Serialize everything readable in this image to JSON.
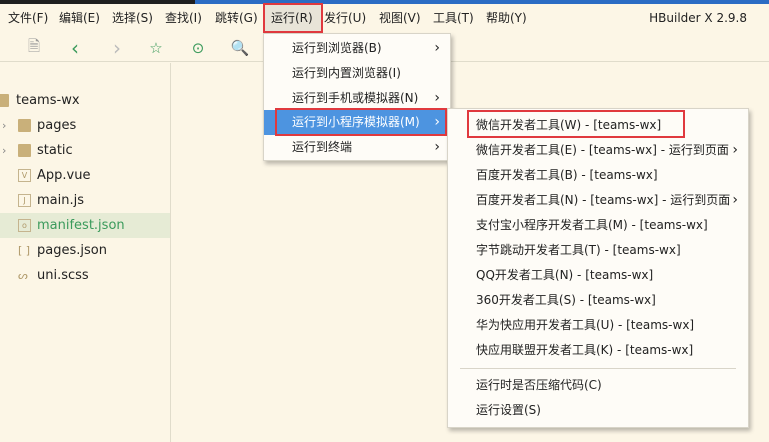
{
  "app_title": "HBuilder X 2.9.8",
  "menubar": [
    "文件(F)",
    "编辑(E)",
    "选择(S)",
    "查找(I)",
    "跳转(G)",
    "运行(R)",
    "发行(U)",
    "视图(V)",
    "工具(T)",
    "帮助(Y)"
  ],
  "toolbar": {
    "icons": [
      "save-icon",
      "back-icon",
      "forward-icon",
      "star-icon",
      "run-icon",
      "preview-search-icon"
    ]
  },
  "tree": {
    "project": "teams-wx",
    "items": [
      {
        "label": "pages",
        "type": "folder"
      },
      {
        "label": "static",
        "type": "folder"
      },
      {
        "label": "App.vue",
        "type": "vue"
      },
      {
        "label": "main.js",
        "type": "js"
      },
      {
        "label": "manifest.json",
        "type": "manifest",
        "selected": true
      },
      {
        "label": "pages.json",
        "type": "json"
      },
      {
        "label": "uni.scss",
        "type": "scss"
      }
    ]
  },
  "run_menu": [
    {
      "label": "运行到浏览器(B)",
      "submenu": true
    },
    {
      "label": "运行到内置浏览器(I)",
      "submenu": false
    },
    {
      "label": "运行到手机或模拟器(N)",
      "submenu": true
    },
    {
      "label": "运行到小程序模拟器(M)",
      "submenu": true,
      "highlighted": true
    },
    {
      "label": "运行到终端",
      "submenu": true
    }
  ],
  "mp_menu": [
    {
      "label": "微信开发者工具(W) - [teams-wx]",
      "submenu": false
    },
    {
      "label": "微信开发者工具(E) - [teams-wx] - 运行到页面",
      "submenu": true
    },
    {
      "label": "百度开发者工具(B) - [teams-wx]",
      "submenu": false
    },
    {
      "label": "百度开发者工具(N) - [teams-wx] - 运行到页面",
      "submenu": true
    },
    {
      "label": "支付宝小程序开发者工具(M) - [teams-wx]",
      "submenu": false
    },
    {
      "label": "字节跳动开发者工具(T) - [teams-wx]",
      "submenu": false
    },
    {
      "label": "QQ开发者工具(N) - [teams-wx]",
      "submenu": false
    },
    {
      "label": "360开发者工具(S) - [teams-wx]",
      "submenu": false
    },
    {
      "label": "华为快应用开发者工具(U) - [teams-wx]",
      "submenu": false
    },
    {
      "label": "快应用联盟开发者工具(K) - [teams-wx]",
      "submenu": false
    }
  ],
  "mp_menu_extra": [
    "运行时是否压缩代码(C)",
    "运行设置(S)"
  ],
  "colors": {
    "highlight": "#4d94e0",
    "annotation": "#e0393e",
    "selected_file": "#3a9a5b"
  }
}
